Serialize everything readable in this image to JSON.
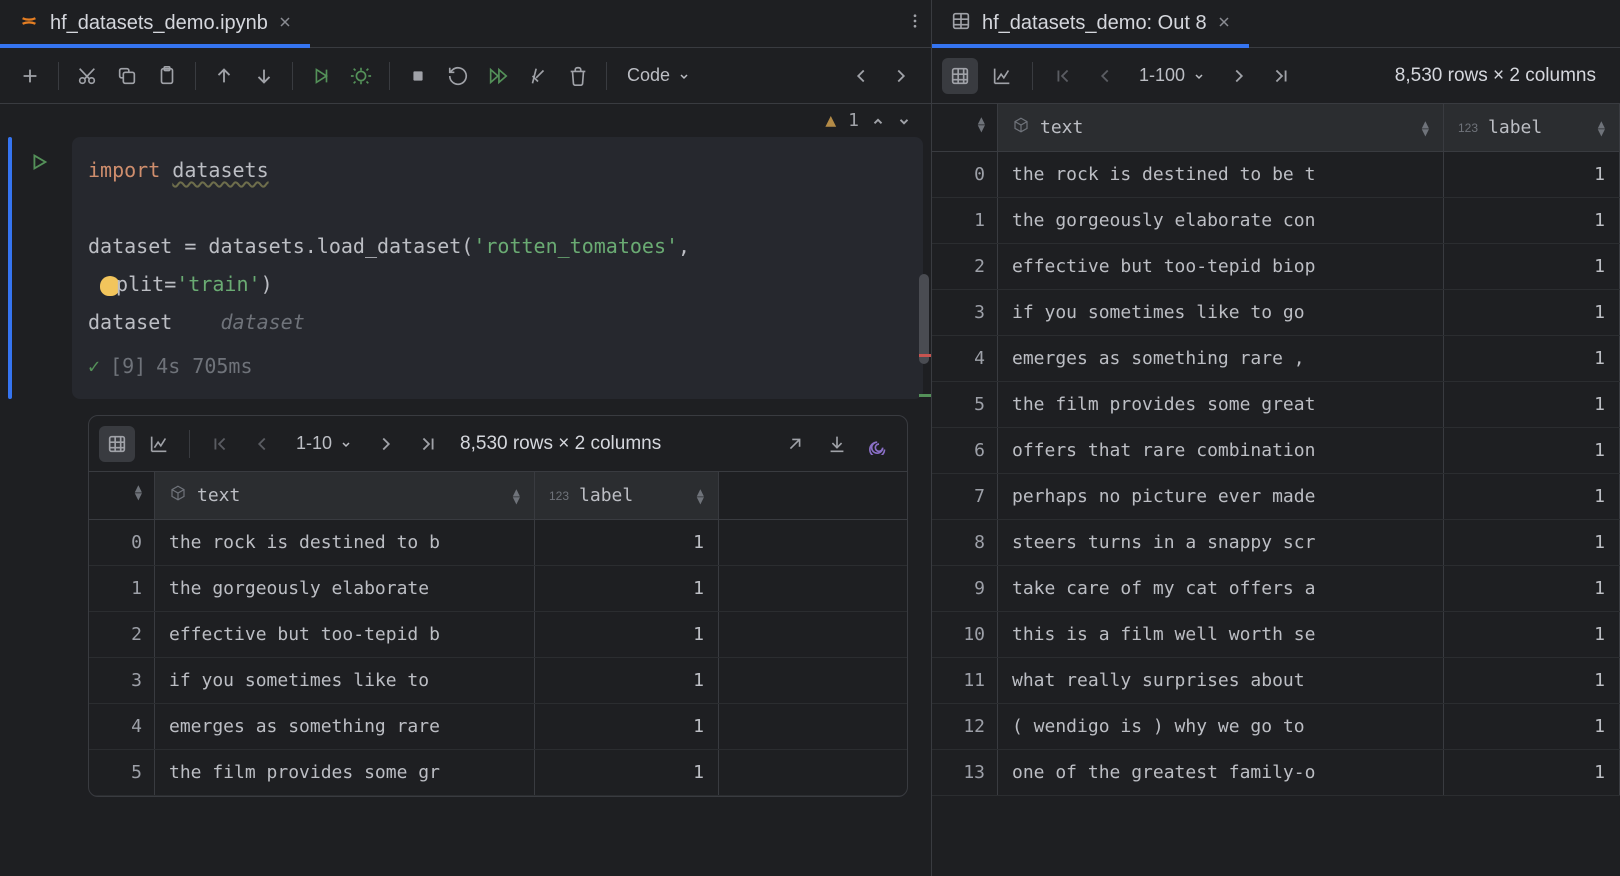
{
  "tabs": {
    "left": {
      "title": "hf_datasets_demo.ipynb"
    },
    "right": {
      "title": "hf_datasets_demo: Out 8"
    }
  },
  "toolbar": {
    "cell_type": "Code"
  },
  "warnings": {
    "count": "1"
  },
  "code": {
    "line1_kw": "import",
    "line1_mod": "datasets",
    "line3_a": "dataset",
    "line3_b": " = datasets.load_dataset(",
    "line3_str": "'rotten_tomatoes'",
    "line3_c": ",",
    "line4_a": "plit=",
    "line4_str": "'train'",
    "line4_b": ")",
    "line5_a": "dataset",
    "line5_hint": "dataset"
  },
  "exec": {
    "run_num": "[9]",
    "time": "4s 705ms"
  },
  "inline_df": {
    "range": "1-10",
    "summary": "8,530 rows × 2 columns",
    "columns": {
      "text": "text",
      "label": "label"
    },
    "rows": [
      {
        "idx": "0",
        "text": "the rock is destined to b",
        "label": "1"
      },
      {
        "idx": "1",
        "text": "the gorgeously elaborate ",
        "label": "1"
      },
      {
        "idx": "2",
        "text": "effective but too-tepid b",
        "label": "1"
      },
      {
        "idx": "3",
        "text": "if you sometimes like to ",
        "label": "1"
      },
      {
        "idx": "4",
        "text": "emerges as something rare",
        "label": "1"
      },
      {
        "idx": "5",
        "text": "the film provides some gr",
        "label": "1"
      }
    ]
  },
  "right_df": {
    "range": "1-100",
    "summary": "8,530 rows × 2 columns",
    "columns": {
      "text": "text",
      "label": "label"
    },
    "rows": [
      {
        "idx": "0",
        "text": "the rock is destined to be t",
        "label": "1"
      },
      {
        "idx": "1",
        "text": "the gorgeously elaborate con",
        "label": "1"
      },
      {
        "idx": "2",
        "text": "effective but too-tepid biop",
        "label": "1"
      },
      {
        "idx": "3",
        "text": "if you sometimes like to go",
        "label": "1"
      },
      {
        "idx": "4",
        "text": "emerges as something rare ,",
        "label": "1"
      },
      {
        "idx": "5",
        "text": "the film provides some great",
        "label": "1"
      },
      {
        "idx": "6",
        "text": "offers that rare combination",
        "label": "1"
      },
      {
        "idx": "7",
        "text": "perhaps no picture ever made",
        "label": "1"
      },
      {
        "idx": "8",
        "text": "steers turns in a snappy scr",
        "label": "1"
      },
      {
        "idx": "9",
        "text": "take care of my cat offers a",
        "label": "1"
      },
      {
        "idx": "10",
        "text": "this is a film well worth se",
        "label": "1"
      },
      {
        "idx": "11",
        "text": "what really surprises about",
        "label": "1"
      },
      {
        "idx": "12",
        "text": "( wendigo is ) why we go to",
        "label": "1"
      },
      {
        "idx": "13",
        "text": "one of the greatest family-o",
        "label": "1"
      }
    ]
  }
}
